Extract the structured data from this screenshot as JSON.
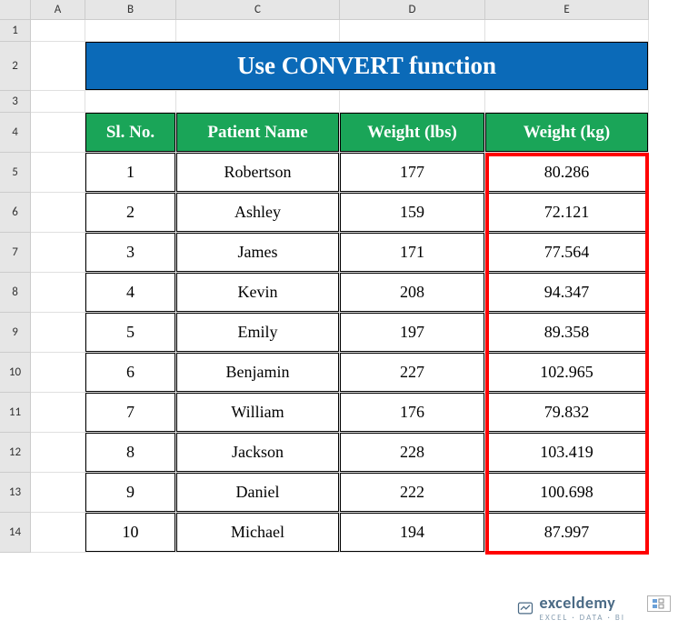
{
  "columns": [
    "A",
    "B",
    "C",
    "D",
    "E"
  ],
  "rows": [
    "1",
    "2",
    "3",
    "4",
    "5",
    "6",
    "7",
    "8",
    "9",
    "10",
    "11",
    "12",
    "13",
    "14"
  ],
  "title": "Use CONVERT function",
  "headers": {
    "sl": "Sl. No.",
    "name": "Patient Name",
    "lbs": "Weight (lbs)",
    "kg": "Weight (kg)"
  },
  "chart_data": {
    "type": "table",
    "title": "Use CONVERT function",
    "columns": [
      "Sl. No.",
      "Patient Name",
      "Weight (lbs)",
      "Weight (kg)"
    ],
    "rows": [
      {
        "sl": 1,
        "name": "Robertson",
        "lbs": 177,
        "kg": 80.286
      },
      {
        "sl": 2,
        "name": "Ashley",
        "lbs": 159,
        "kg": 72.121
      },
      {
        "sl": 3,
        "name": "James",
        "lbs": 171,
        "kg": 77.564
      },
      {
        "sl": 4,
        "name": "Kevin",
        "lbs": 208,
        "kg": 94.347
      },
      {
        "sl": 5,
        "name": "Emily",
        "lbs": 197,
        "kg": 89.358
      },
      {
        "sl": 6,
        "name": "Benjamin",
        "lbs": 227,
        "kg": 102.965
      },
      {
        "sl": 7,
        "name": "William",
        "lbs": 176,
        "kg": 79.832
      },
      {
        "sl": 8,
        "name": "Jackson",
        "lbs": 228,
        "kg": 103.419
      },
      {
        "sl": 9,
        "name": "Daniel",
        "lbs": 222,
        "kg": 100.698
      },
      {
        "sl": 10,
        "name": "Michael",
        "lbs": 194,
        "kg": 87.997
      }
    ]
  },
  "watermark": {
    "brand": "exceldemy",
    "tag": "EXCEL · DATA · BI"
  }
}
